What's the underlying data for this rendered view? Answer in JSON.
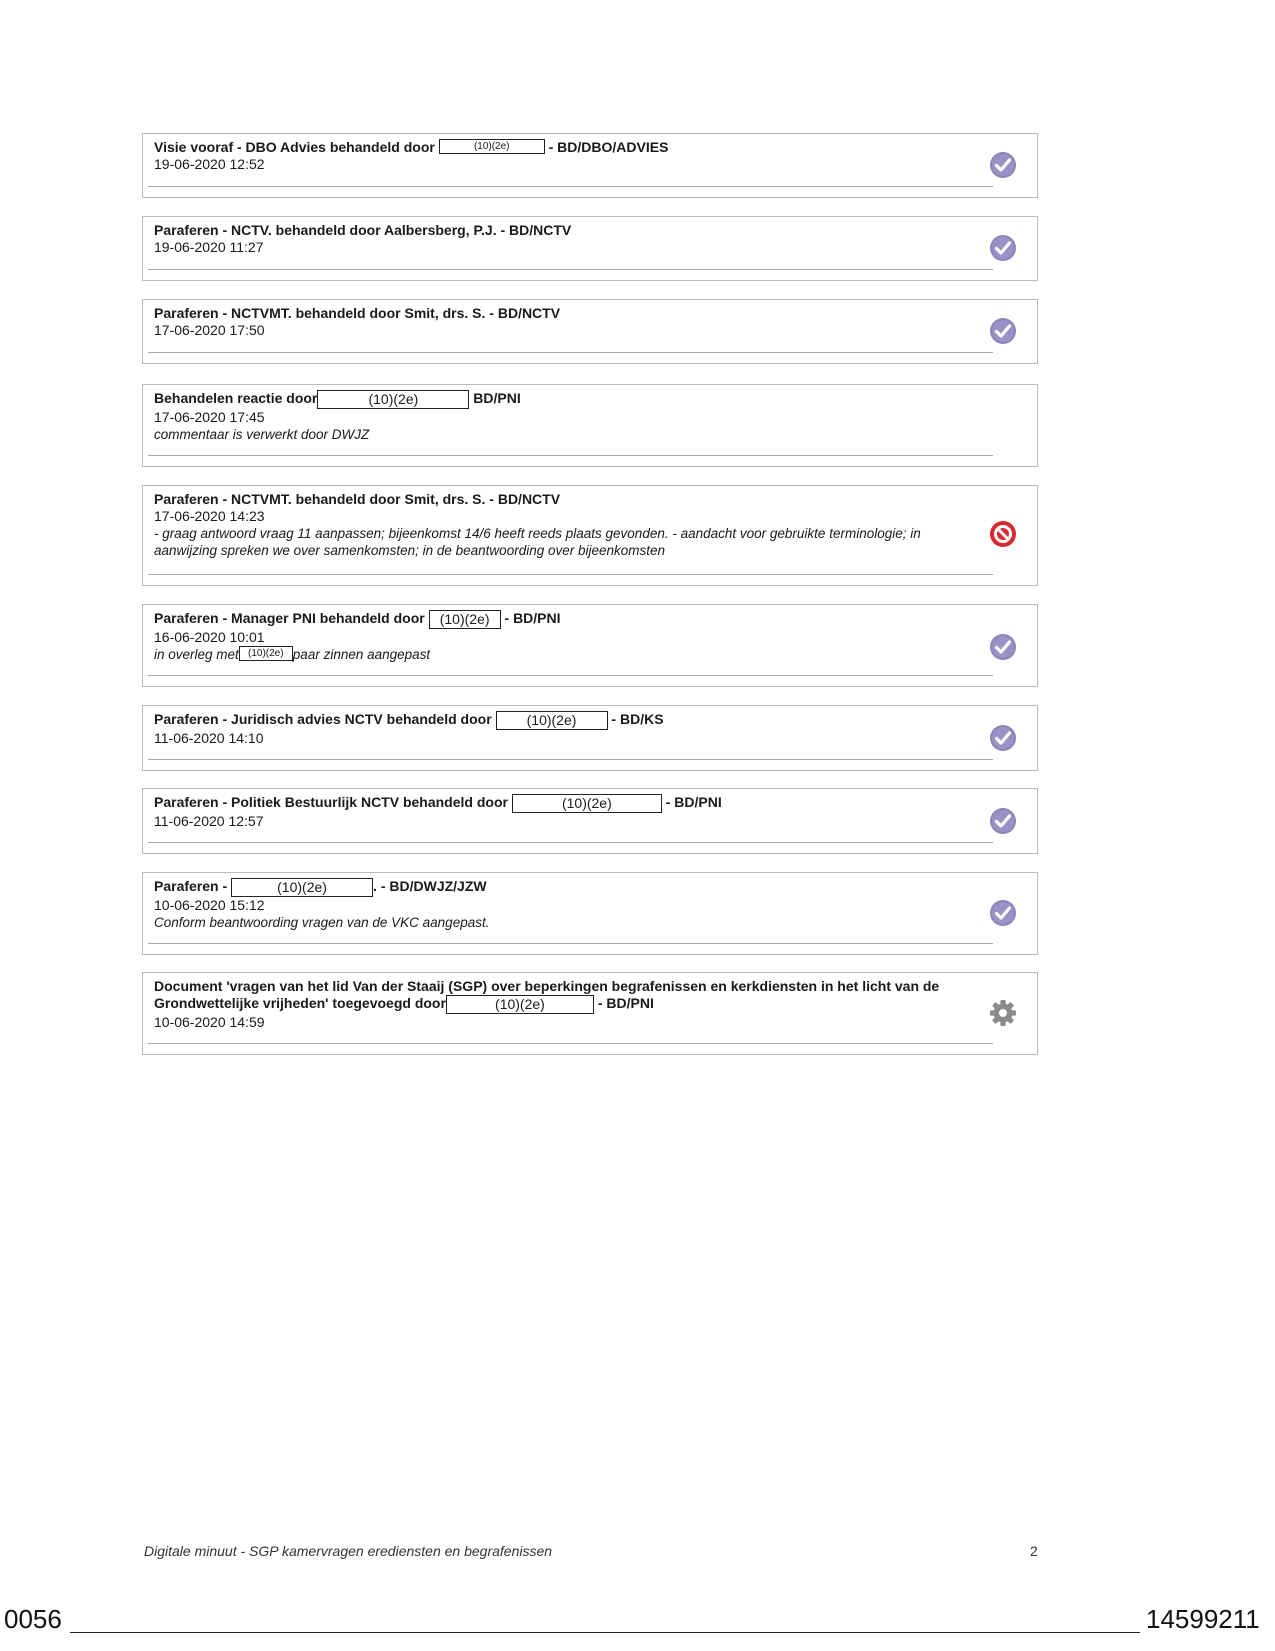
{
  "redaction_label": "(10)(2e)",
  "entries": [
    {
      "title_a": "Visie vooraf - DBO Advies behandeld door",
      "title_b": "- BD/DBO/ADVIES",
      "date": "19-06-2020 12:52",
      "status": "approved"
    },
    {
      "title_a": "Paraferen - NCTV. behandeld door Aalbersberg, P.J. - BD/NCTV",
      "date": "19-06-2020 11:27",
      "status": "approved"
    },
    {
      "title_a": "Paraferen - NCTVMT. behandeld door Smit, drs. S. - BD/NCTV",
      "date": "17-06-2020 17:50",
      "status": "approved"
    },
    {
      "title_a": "Behandelen reactie door",
      "title_b": "BD/PNI",
      "date": "17-06-2020 17:45",
      "comment": "commentaar is verwerkt door DWJZ"
    },
    {
      "title_a": "Paraferen - NCTVMT. behandeld door Smit, drs. S. - BD/NCTV",
      "date": "17-06-2020 14:23",
      "comment": "- graag antwoord vraag 11 aanpassen; bijeenkomst 14/6 heeft reeds plaats gevonden. - aandacht voor gebruikte terminologie; in aanwijzing spreken we over samenkomsten; in de beantwoording over bijeenkomsten",
      "status": "rejected"
    },
    {
      "title_a": "Paraferen - Manager PNI behandeld door",
      "title_b": "- BD/PNI",
      "date": "16-06-2020 10:01",
      "comment_a": "in overleg met",
      "comment_b": "paar zinnen aangepast",
      "status": "approved"
    },
    {
      "title_a": "Paraferen - Juridisch advies NCTV behandeld door",
      "title_b": "- BD/KS",
      "date": "11-06-2020 14:10",
      "status": "approved"
    },
    {
      "title_a": "Paraferen - Politiek Bestuurlijk NCTV behandeld door",
      "title_b": "- BD/PNI",
      "date": "11-06-2020 12:57",
      "status": "approved"
    },
    {
      "title_a": "Paraferen -",
      "title_b": ". - BD/DWJZ/JZW",
      "date": "10-06-2020 15:12",
      "comment": "Conform beantwoording vragen van de VKC aangepast.",
      "status": "approved"
    },
    {
      "title_a": "Document 'vragen van het lid Van der Staaij (SGP) over beperkingen begrafenissen en kerkdiensten in het licht van de Grondwettelijke vrijheden' toegevoegd door",
      "title_b": "- BD/PNI",
      "date": "10-06-2020 14:59",
      "status": "created"
    }
  ],
  "footer": {
    "title": "Digitale minuut - SGP kamervragen erediensten en begrafenissen",
    "page": "2"
  },
  "stamp": {
    "left": "0056",
    "right": "14599211"
  },
  "colors": {
    "approved": "#8e84b9",
    "rejected": "#d8292f",
    "created": "#8a8a8a"
  }
}
